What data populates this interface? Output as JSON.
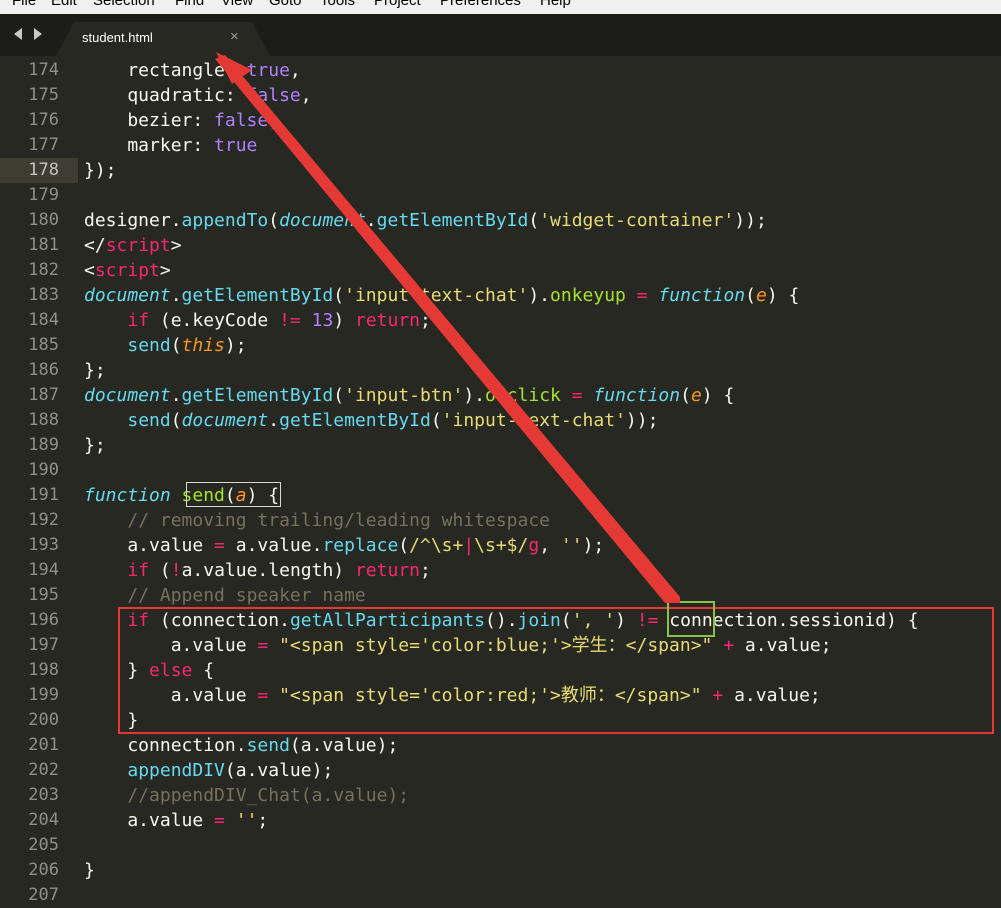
{
  "menu": [
    "File",
    "Edit",
    "Selection",
    "Find",
    "View",
    "Goto",
    "Tools",
    "Project",
    "Preferences",
    "Help"
  ],
  "tab": {
    "title": "student.html",
    "close_glyph": "×"
  },
  "editor": {
    "active_line": 178,
    "lines": [
      {
        "n": 174,
        "tokens": [
          [
            "plain",
            "    rectangle: "
          ],
          [
            "num",
            "true"
          ],
          [
            "plain",
            ","
          ]
        ]
      },
      {
        "n": 175,
        "tokens": [
          [
            "plain",
            "    quadratic: "
          ],
          [
            "num",
            "false"
          ],
          [
            "plain",
            ","
          ]
        ]
      },
      {
        "n": 176,
        "tokens": [
          [
            "plain",
            "    bezier: "
          ],
          [
            "num",
            "false"
          ],
          [
            "plain",
            ","
          ]
        ]
      },
      {
        "n": 177,
        "tokens": [
          [
            "plain",
            "    marker: "
          ],
          [
            "num",
            "true"
          ]
        ]
      },
      {
        "n": 178,
        "tokens": [
          [
            "plain",
            "});"
          ]
        ]
      },
      {
        "n": 179,
        "tokens": []
      },
      {
        "n": 180,
        "tokens": [
          [
            "plain",
            "designer."
          ],
          [
            "bf",
            "appendTo"
          ],
          [
            "plain",
            "("
          ],
          [
            "sto",
            "document"
          ],
          [
            "plain",
            "."
          ],
          [
            "bf",
            "getElementById"
          ],
          [
            "plain",
            "("
          ],
          [
            "str",
            "'widget-container'"
          ],
          [
            "plain",
            "));"
          ]
        ]
      },
      {
        "n": 181,
        "tokens": [
          [
            "plain",
            "</"
          ],
          [
            "kw",
            "script"
          ],
          [
            "plain",
            ">"
          ]
        ]
      },
      {
        "n": 182,
        "tokens": [
          [
            "plain",
            "<"
          ],
          [
            "kw",
            "script"
          ],
          [
            "plain",
            ">"
          ]
        ]
      },
      {
        "n": 183,
        "tokens": [
          [
            "sto",
            "document"
          ],
          [
            "plain",
            "."
          ],
          [
            "bf",
            "getElementById"
          ],
          [
            "plain",
            "("
          ],
          [
            "str",
            "'input-text-chat'"
          ],
          [
            "plain",
            ")."
          ],
          [
            "fn",
            "onkeyup"
          ],
          [
            "plain",
            " "
          ],
          [
            "kw",
            "="
          ],
          [
            "plain",
            " "
          ],
          [
            "sto",
            "function"
          ],
          [
            "plain",
            "("
          ],
          [
            "arg",
            "e"
          ],
          [
            "plain",
            ") {"
          ]
        ]
      },
      {
        "n": 184,
        "tokens": [
          [
            "plain",
            "    "
          ],
          [
            "kw",
            "if"
          ],
          [
            "plain",
            " (e.keyCode "
          ],
          [
            "kw",
            "!="
          ],
          [
            "plain",
            " "
          ],
          [
            "num",
            "13"
          ],
          [
            "plain",
            ") "
          ],
          [
            "kw",
            "return"
          ],
          [
            "plain",
            ";"
          ]
        ]
      },
      {
        "n": 185,
        "tokens": [
          [
            "plain",
            "    "
          ],
          [
            "bf",
            "send"
          ],
          [
            "plain",
            "("
          ],
          [
            "arg",
            "this"
          ],
          [
            "plain",
            ");"
          ]
        ]
      },
      {
        "n": 186,
        "tokens": [
          [
            "plain",
            "};"
          ]
        ]
      },
      {
        "n": 187,
        "tokens": [
          [
            "sto",
            "document"
          ],
          [
            "plain",
            "."
          ],
          [
            "bf",
            "getElementById"
          ],
          [
            "plain",
            "("
          ],
          [
            "str",
            "'input-btn'"
          ],
          [
            "plain",
            ")."
          ],
          [
            "fn",
            "onclick"
          ],
          [
            "plain",
            " "
          ],
          [
            "kw",
            "="
          ],
          [
            "plain",
            " "
          ],
          [
            "sto",
            "function"
          ],
          [
            "plain",
            "("
          ],
          [
            "arg",
            "e"
          ],
          [
            "plain",
            ") {"
          ]
        ]
      },
      {
        "n": 188,
        "tokens": [
          [
            "plain",
            "    "
          ],
          [
            "bf",
            "send"
          ],
          [
            "plain",
            "("
          ],
          [
            "sto",
            "document"
          ],
          [
            "plain",
            "."
          ],
          [
            "bf",
            "getElementById"
          ],
          [
            "plain",
            "("
          ],
          [
            "str",
            "'input-text-chat'"
          ],
          [
            "plain",
            "));"
          ]
        ]
      },
      {
        "n": 189,
        "tokens": [
          [
            "plain",
            "};"
          ]
        ]
      },
      {
        "n": 190,
        "tokens": []
      },
      {
        "n": 191,
        "tokens": [
          [
            "sto",
            "function"
          ],
          [
            "plain",
            " "
          ],
          [
            "fn",
            "send"
          ],
          [
            "plain",
            "("
          ],
          [
            "arg",
            "a"
          ],
          [
            "plain",
            ") {"
          ]
        ]
      },
      {
        "n": 192,
        "tokens": [
          [
            "plain",
            "    "
          ],
          [
            "cmt",
            "// removing trailing/leading whitespace"
          ]
        ]
      },
      {
        "n": 193,
        "tokens": [
          [
            "plain",
            "    a.value "
          ],
          [
            "kw",
            "="
          ],
          [
            "plain",
            " a.value."
          ],
          [
            "bf",
            "replace"
          ],
          [
            "plain",
            "("
          ],
          [
            "str",
            "/^\\s+"
          ],
          [
            "kw",
            "|"
          ],
          [
            "str",
            "\\s+$/"
          ],
          [
            "kw",
            "g"
          ],
          [
            "plain",
            ", "
          ],
          [
            "str",
            "''"
          ],
          [
            "plain",
            ");"
          ]
        ]
      },
      {
        "n": 194,
        "tokens": [
          [
            "plain",
            "    "
          ],
          [
            "kw",
            "if"
          ],
          [
            "plain",
            " ("
          ],
          [
            "kw",
            "!"
          ],
          [
            "plain",
            "a.value.length) "
          ],
          [
            "kw",
            "return"
          ],
          [
            "plain",
            ";"
          ]
        ]
      },
      {
        "n": 195,
        "tokens": [
          [
            "plain",
            "    "
          ],
          [
            "cmt",
            "// Append speaker name"
          ]
        ]
      },
      {
        "n": 196,
        "tokens": [
          [
            "plain",
            "    "
          ],
          [
            "kw",
            "if"
          ],
          [
            "plain",
            " (connection."
          ],
          [
            "bf",
            "getAllParticipants"
          ],
          [
            "plain",
            "()."
          ],
          [
            "bf",
            "join"
          ],
          [
            "plain",
            "("
          ],
          [
            "str",
            "', '"
          ],
          [
            "plain",
            ") "
          ],
          [
            "kw",
            "!="
          ],
          [
            "plain",
            " connection.sessionid) {"
          ]
        ]
      },
      {
        "n": 197,
        "tokens": [
          [
            "plain",
            "        a.value "
          ],
          [
            "kw",
            "="
          ],
          [
            "plain",
            " "
          ],
          [
            "str",
            "\"<span style='color:blue;'>学生：</span>\""
          ],
          [
            "plain",
            " "
          ],
          [
            "kw",
            "+"
          ],
          [
            "plain",
            " a.value;"
          ]
        ]
      },
      {
        "n": 198,
        "tokens": [
          [
            "plain",
            "    } "
          ],
          [
            "kw",
            "else"
          ],
          [
            "plain",
            " {"
          ]
        ]
      },
      {
        "n": 199,
        "tokens": [
          [
            "plain",
            "        a.value "
          ],
          [
            "kw",
            "="
          ],
          [
            "plain",
            " "
          ],
          [
            "str",
            "\"<span style='color:red;'>教师：</span>\""
          ],
          [
            "plain",
            " "
          ],
          [
            "kw",
            "+"
          ],
          [
            "plain",
            " a.value;"
          ]
        ]
      },
      {
        "n": 200,
        "tokens": [
          [
            "plain",
            "    }"
          ]
        ]
      },
      {
        "n": 201,
        "tokens": [
          [
            "plain",
            "    connection."
          ],
          [
            "bf",
            "send"
          ],
          [
            "plain",
            "(a.value);"
          ]
        ]
      },
      {
        "n": 202,
        "tokens": [
          [
            "plain",
            "    "
          ],
          [
            "bf",
            "appendDIV"
          ],
          [
            "plain",
            "(a.value);"
          ]
        ]
      },
      {
        "n": 203,
        "tokens": [
          [
            "plain",
            "    "
          ],
          [
            "cmt",
            "//appendDIV_Chat(a.value);"
          ]
        ]
      },
      {
        "n": 204,
        "tokens": [
          [
            "plain",
            "    a.value "
          ],
          [
            "kw",
            "="
          ],
          [
            "plain",
            " "
          ],
          [
            "str",
            "''"
          ],
          [
            "plain",
            ";"
          ]
        ]
      },
      {
        "n": 205,
        "tokens": []
      },
      {
        "n": 206,
        "tokens": [
          [
            "plain",
            "}"
          ]
        ]
      },
      {
        "n": 207,
        "tokens": []
      }
    ]
  },
  "colors": {
    "background": "#272822",
    "annotation_red": "#e53935",
    "annotation_green": "#8bc34a"
  }
}
